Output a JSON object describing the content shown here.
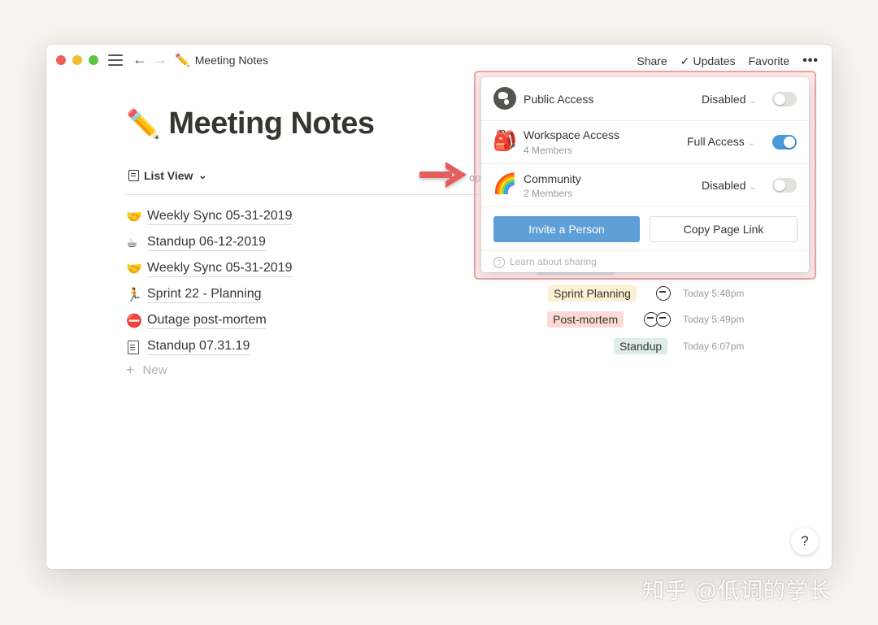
{
  "window": {
    "breadcrumb": {
      "emoji": "✏️",
      "title": "Meeting Notes"
    },
    "topbar": {
      "share": "Share",
      "updates": "Updates",
      "favorite": "Favorite",
      "more": "•••",
      "check": "✓"
    }
  },
  "page": {
    "emoji": "✏️",
    "title": "Meeting Notes",
    "view": "List View",
    "view_chevron": "⌄",
    "partial_text": "op",
    "new_label": "New",
    "plus": "+",
    "help": "?",
    "rows": [
      {
        "emoji": "🤝",
        "title": "Weekly Sync 05-31-2019"
      },
      {
        "emoji": "☕",
        "title": "Standup 06-12-2019"
      },
      {
        "emoji": "🤝",
        "title": "Weekly Sync 05-31-2019"
      },
      {
        "emoji": "🏃",
        "title": "Sprint 22 - Planning",
        "tag": "Sprint Planning",
        "time": "Today 5:48pm"
      },
      {
        "emoji": "⛔",
        "title": "Outage post-mortem",
        "tag": "Post-mortem",
        "time": "Today 5:49pm"
      },
      {
        "emoji": "",
        "title": "Standup 07.31.19",
        "tag": "Standup",
        "time": "Today 6:07pm"
      }
    ]
  },
  "share_popover": {
    "rows": [
      {
        "label": "Public Access",
        "sub": "",
        "value": "Disabled",
        "enabled": false
      },
      {
        "label": "Workspace Access",
        "sub": "4 Members",
        "value": "Full Access",
        "enabled": true
      },
      {
        "label": "Community",
        "sub": "2 Members",
        "value": "Disabled",
        "enabled": false
      }
    ],
    "invite": "Invite a Person",
    "copy_link": "Copy Page Link",
    "learn": "Learn about sharing"
  },
  "watermark": "知乎 @低调的学长",
  "colors": {
    "accent": "#5d9fd6",
    "highlight": "#eba4a4",
    "arrow": "#e55d5d"
  }
}
